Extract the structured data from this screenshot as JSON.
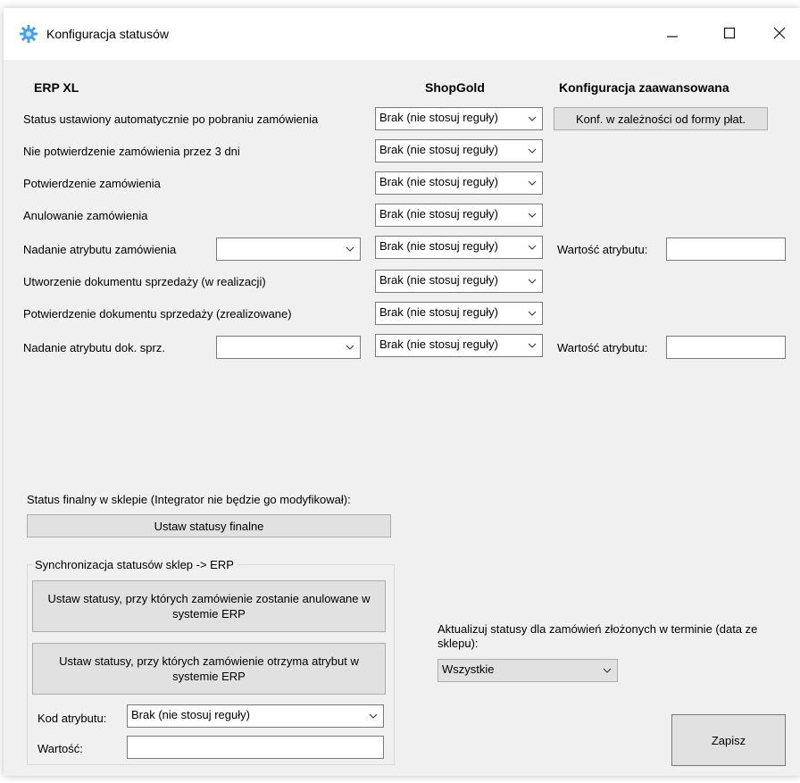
{
  "window": {
    "title": "Konfiguracja statusów",
    "minimize_glyph": "—",
    "maximize_glyph": "☐",
    "close_glyph": "✕"
  },
  "headers": {
    "erp": "ERP XL",
    "shop": "ShopGold",
    "advanced": "Konfiguracja zaawansowana"
  },
  "rows": [
    {
      "label": "Status ustawiony automatycznie po pobraniu zamówienia",
      "shop_value": "Brak (nie stosuj reguły)"
    },
    {
      "label": "Nie potwierdzenie zamówienia przez 3 dni",
      "shop_value": "Brak (nie stosuj reguły)"
    },
    {
      "label": "Potwierdzenie zamówienia",
      "shop_value": "Brak (nie stosuj reguły)"
    },
    {
      "label": "Anulowanie zamówienia",
      "shop_value": "Brak (nie stosuj reguły)"
    },
    {
      "label": "Nadanie atrybutu zamówienia",
      "shop_value": "Brak (nie stosuj reguły)",
      "attr_combo_value": "",
      "attr_value_label": "Wartość atrybutu:",
      "attr_value": ""
    },
    {
      "label": "Utworzenie dokumentu sprzedaży (w realizacji)",
      "shop_value": "Brak (nie stosuj reguły)"
    },
    {
      "label": "Potwierdzenie dokumentu sprzedaży (zrealizowane)",
      "shop_value": "Brak (nie stosuj reguły)"
    },
    {
      "label": "Nadanie atrybutu dok. sprz.",
      "shop_value": "Brak (nie stosuj reguły)",
      "attr_combo_value": "",
      "attr_value_label": "Wartość atrybutu:",
      "attr_value": ""
    }
  ],
  "advanced_button": "Konf. w zależności od formy płat.",
  "final_status": {
    "label": "Status finalny w sklepie (Integrator nie będzie go modyfikował):",
    "button": "Ustaw statusy finalne"
  },
  "sync": {
    "group_title": "Synchronizacja statusów sklep -> ERP",
    "cancel_button": "Ustaw statusy, przy których zamówienie zostanie anulowane w systemie ERP",
    "attr_button": "Ustaw statusy, przy których zamówienie otrzyma atrybut w systemie ERP",
    "attr_code_label": "Kod atrybutu:",
    "attr_code_value": "Brak (nie stosuj reguły)",
    "value_label": "Wartość:",
    "value": ""
  },
  "update": {
    "label": "Aktualizuj statusy dla zamówień złożonych w terminie (data ze sklepu):",
    "value": "Wszystkie"
  },
  "save_button": "Zapisz",
  "colors": {
    "icon_blue": "#4a9fe0",
    "button_bg": "#e1e1e1",
    "window_bg": "#f0f0f0"
  }
}
